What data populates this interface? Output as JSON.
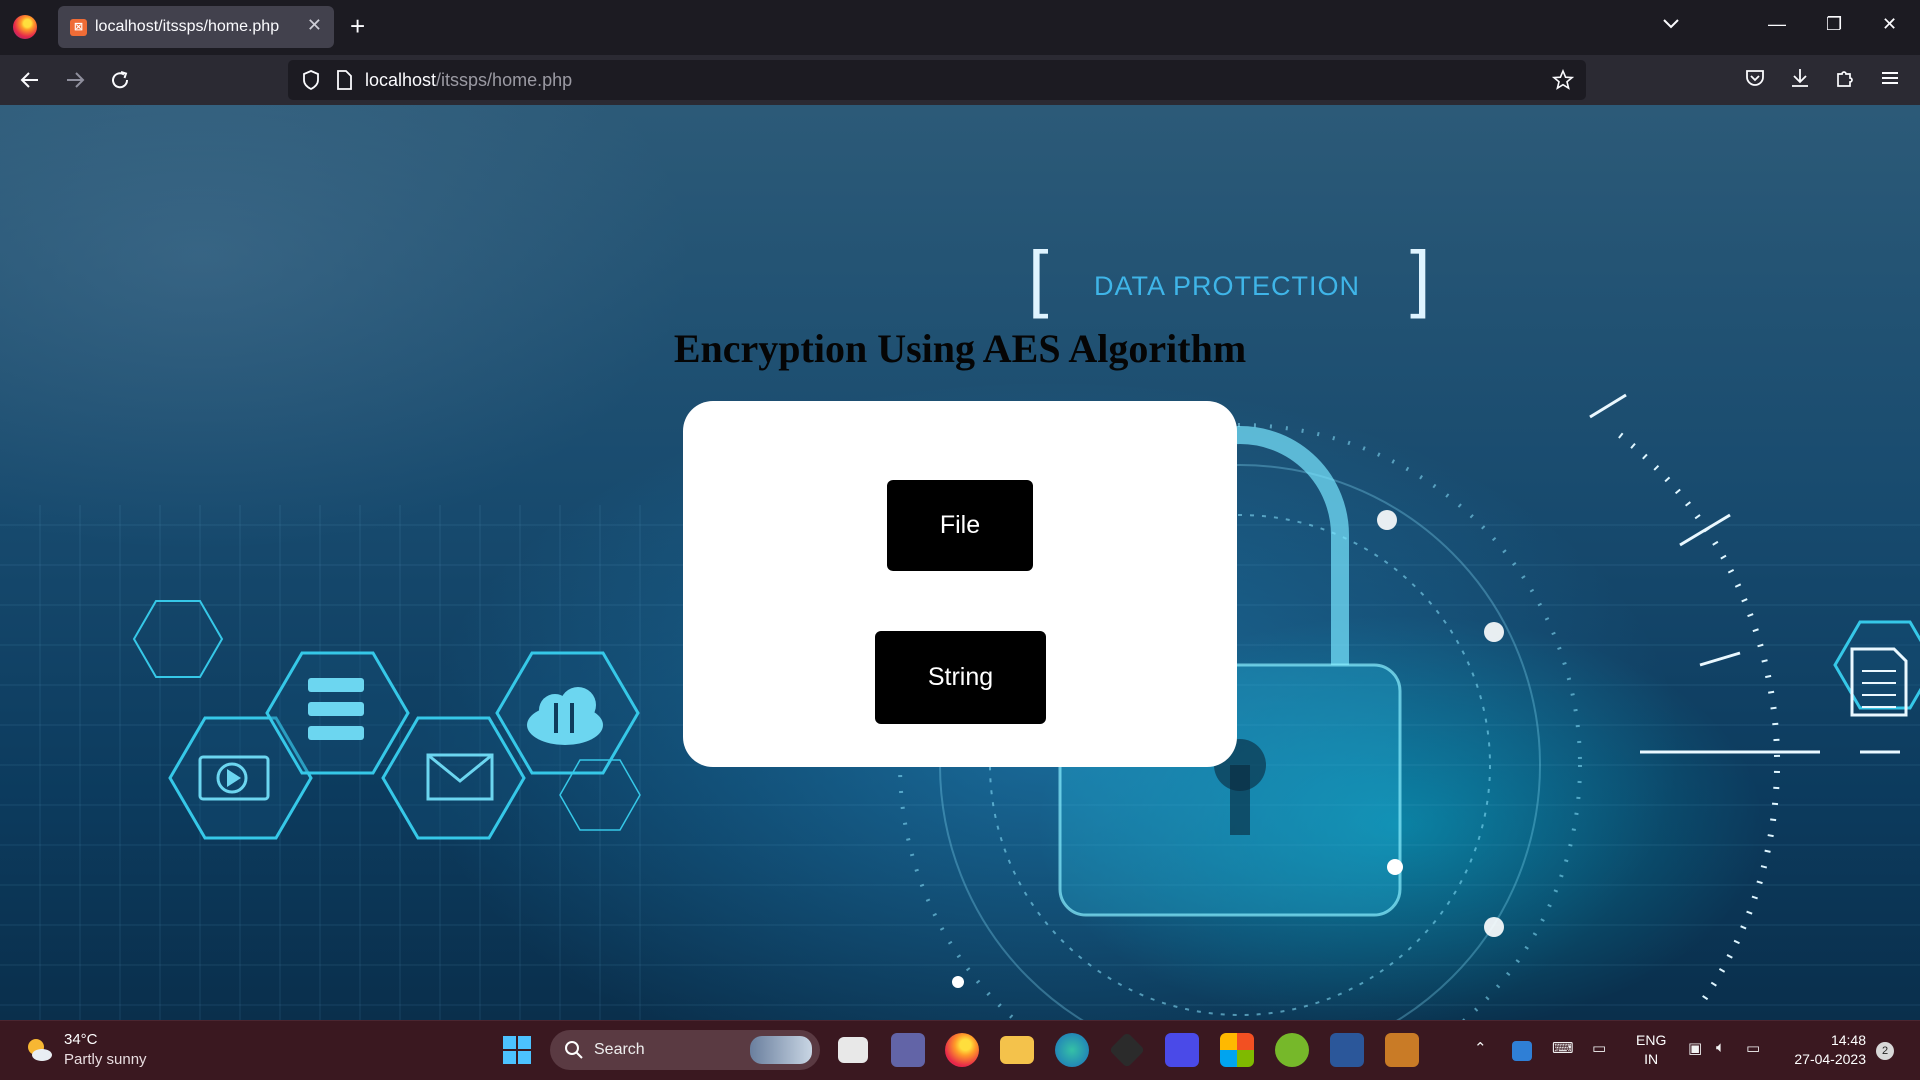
{
  "browser": {
    "tab_title": "localhost/itssps/home.php",
    "tab_close": "✕",
    "new_tab": "+",
    "url_host": "localhost",
    "url_path": "/itssps/home.php",
    "window_controls": {
      "minimize": "—",
      "restore": "❐",
      "close": "✕"
    }
  },
  "page": {
    "banner_text": "DATA PROTECTION",
    "bracket_left": "[",
    "bracket_right": "]",
    "heading": "Encryption Using AES Algorithm",
    "buttons": {
      "file": "File",
      "string": "String"
    }
  },
  "taskbar": {
    "weather_temp": "34°C",
    "weather_desc": "Partly sunny",
    "search_placeholder": "Search",
    "lang_top": "ENG",
    "lang_bottom": "IN",
    "time": "14:48",
    "date": "27-04-2023",
    "notification_count": "2"
  },
  "colors": {
    "accent_cyan": "#3fb5e8",
    "button_bg": "#000000",
    "card_bg": "#ffffff",
    "taskbar_bg": "#3a1820"
  }
}
